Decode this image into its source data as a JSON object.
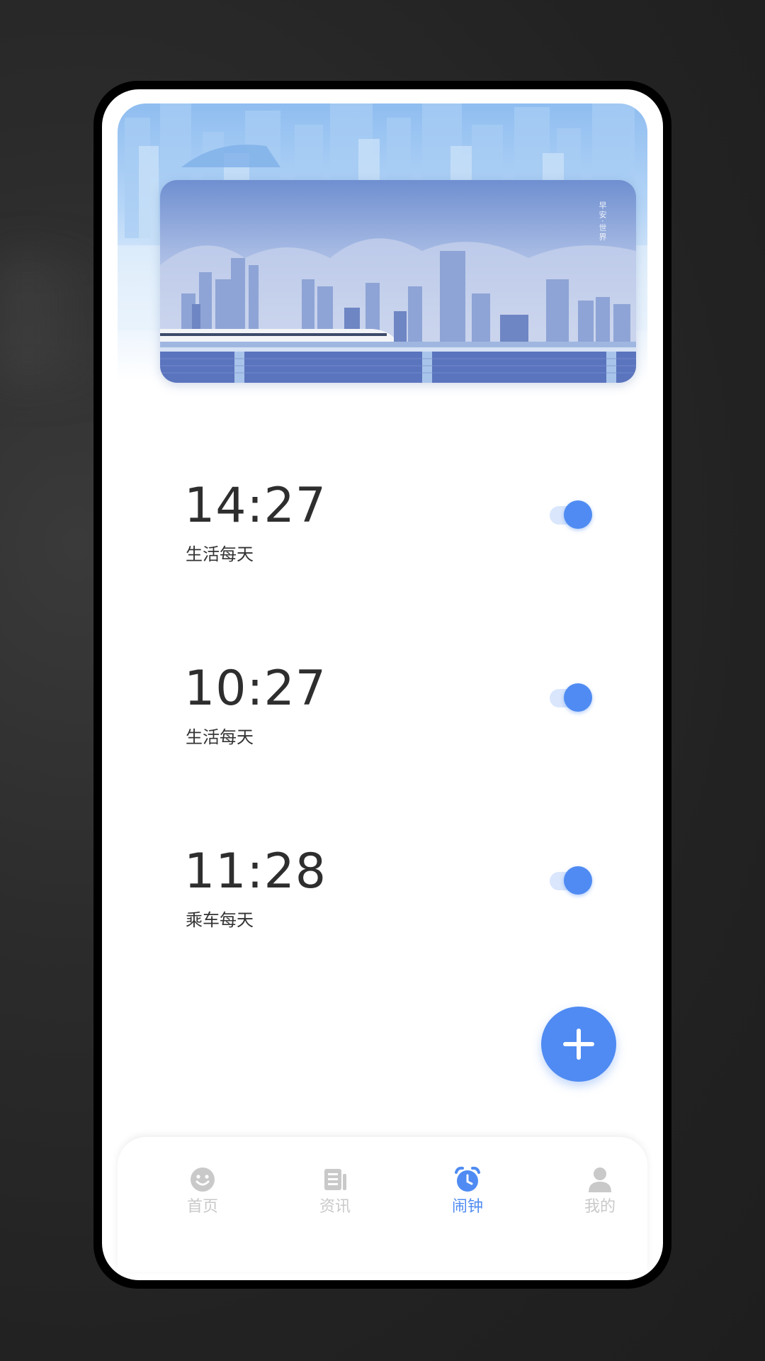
{
  "banner": {
    "caption": "早安·世界"
  },
  "alarms": [
    {
      "time": "14:27",
      "label": "生活每天",
      "enabled": true
    },
    {
      "time": "10:27",
      "label": "生活每天",
      "enabled": true
    },
    {
      "time": "11:28",
      "label": "乘车每天",
      "enabled": true
    }
  ],
  "fab": {
    "icon": "plus-icon"
  },
  "tabs": [
    {
      "label": "首页",
      "icon": "smiley-icon",
      "active": false
    },
    {
      "label": "资讯",
      "icon": "news-icon",
      "active": false
    },
    {
      "label": "闹钟",
      "icon": "alarm-clock-icon",
      "active": true
    },
    {
      "label": "我的",
      "icon": "person-icon",
      "active": false
    }
  ],
  "colors": {
    "accent": "#4f8bf2",
    "inactive": "#c9c9c9",
    "text": "#2e2e2e",
    "toggle_track": "#d9e6fc"
  }
}
